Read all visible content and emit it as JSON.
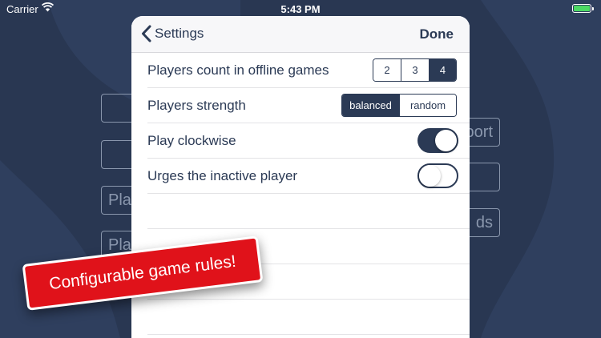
{
  "status_bar": {
    "carrier": "Carrier",
    "time": "5:43 PM"
  },
  "background_menu": {
    "left_buttons": [
      "",
      "",
      "Play",
      "Pla"
    ],
    "right_buttons": [
      "port",
      "",
      "ds"
    ]
  },
  "settings": {
    "back_label": "Settings",
    "done_label": "Done",
    "rows": {
      "players_count": {
        "label": "Players count in offline games",
        "options": [
          "2",
          "3",
          "4"
        ],
        "selected": "4"
      },
      "players_strength": {
        "label": "Players strength",
        "options": [
          "balanced",
          "random"
        ],
        "selected": "balanced"
      },
      "play_clockwise": {
        "label": "Play clockwise",
        "on": true
      },
      "urges_inactive": {
        "label": "Urges the inactive player",
        "on": false
      }
    }
  },
  "promo": {
    "text": "Configurable game rules!"
  },
  "colors": {
    "background": "#293752",
    "accent": "#2b3a55",
    "promo_red": "#e0121a",
    "battery_green": "#4cd964"
  }
}
